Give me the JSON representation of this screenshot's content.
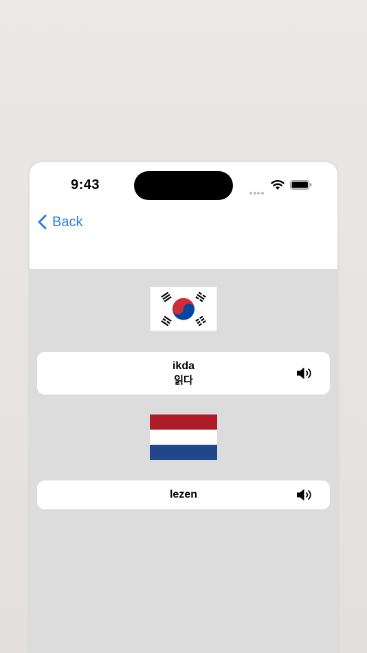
{
  "status_bar": {
    "time": "9:43"
  },
  "nav": {
    "back_label": "Back"
  },
  "korean": {
    "flag": "south-korea-flag",
    "romanization": "ikda",
    "hangul": "읽다"
  },
  "dutch": {
    "flag": "netherlands-flag",
    "word": "lezen"
  },
  "colors": {
    "accent": "#2a7de1",
    "content_bg": "#dcdcdc",
    "card_bg": "#ffffff"
  }
}
